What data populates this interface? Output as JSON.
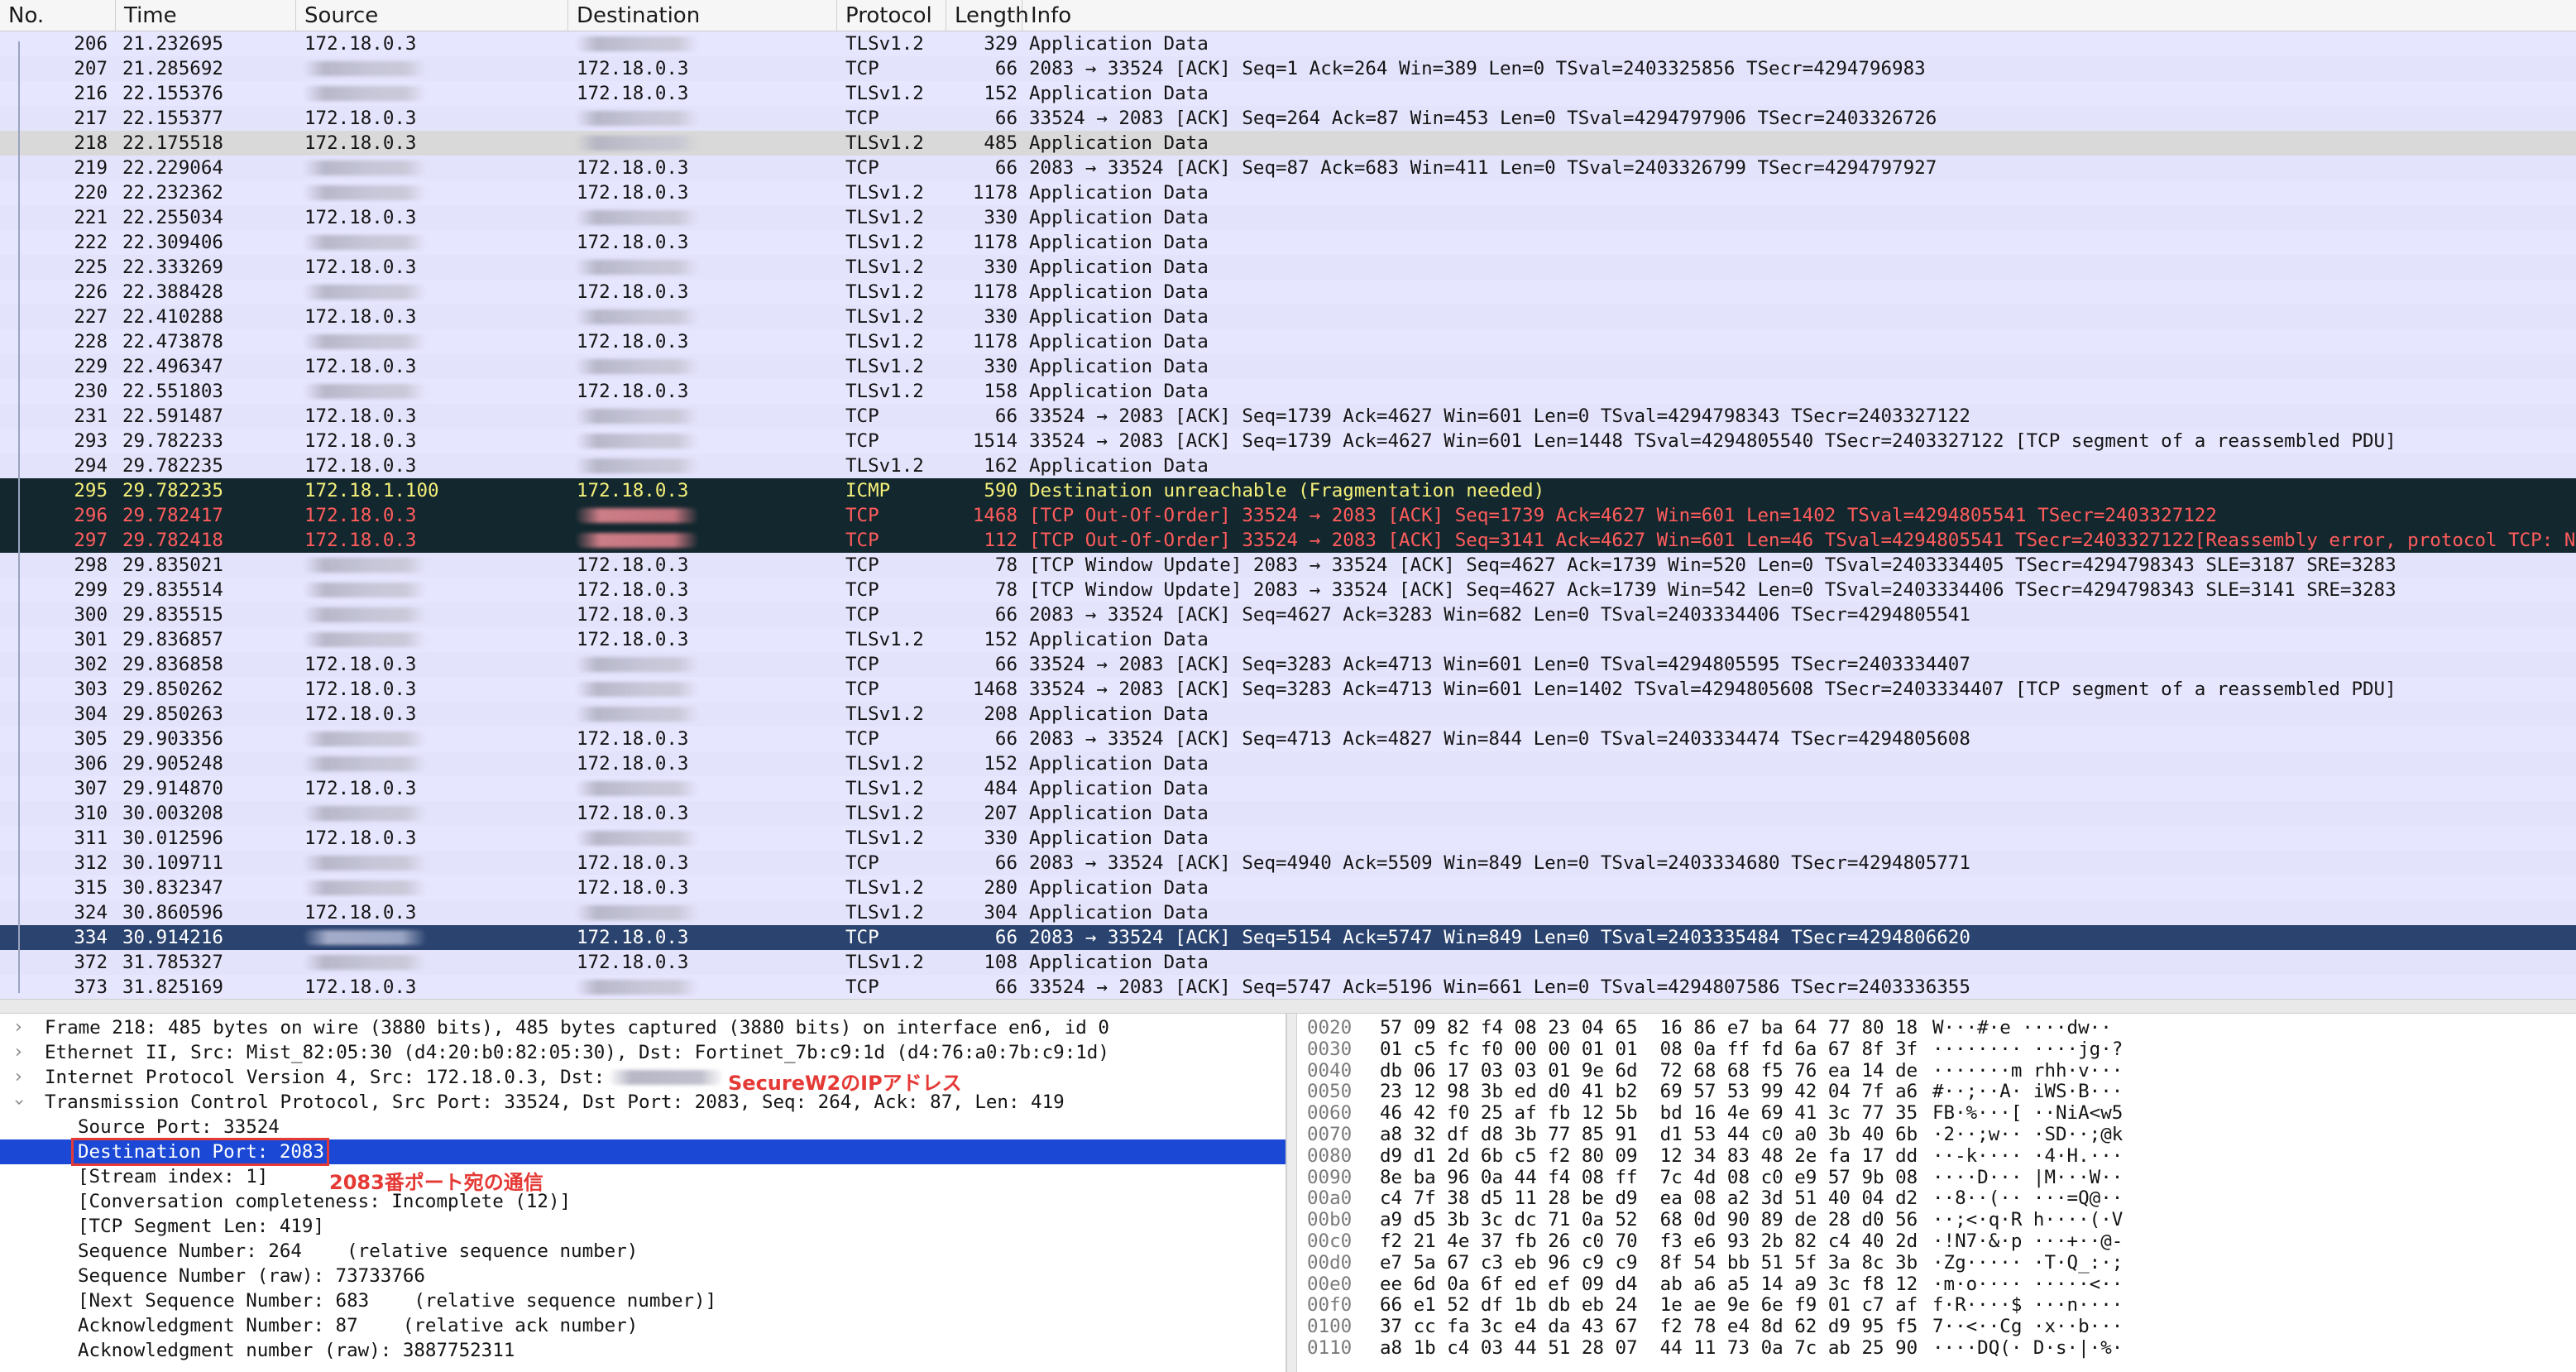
{
  "columns": [
    "No.",
    "Time",
    "Source",
    "Destination",
    "Protocol",
    "Length",
    "Info"
  ],
  "colors": {
    "normal_row_bg": "#e7e6ff",
    "selected_gray_bg": "#d9d9d9",
    "dark_row_bg": "#12272e",
    "icmp_text": "#f5f07a",
    "error_text": "#ff5c5c",
    "current_row_bg": "#2b436f",
    "details_selected_bg": "#1b49d6",
    "annotation_red": "#e53935"
  },
  "packets": [
    {
      "no": "206",
      "time": "21.232695",
      "src": "172.18.0.3",
      "dst": "",
      "proto": "TLSv1.2",
      "len": "329",
      "info": "Application Data",
      "style": "normal"
    },
    {
      "no": "207",
      "time": "21.285692",
      "src": "",
      "dst": "172.18.0.3",
      "proto": "TCP",
      "len": "66",
      "info": "2083 → 33524 [ACK] Seq=1 Ack=264 Win=389 Len=0 TSval=2403325856 TSecr=4294796983",
      "style": "normal"
    },
    {
      "no": "216",
      "time": "22.155376",
      "src": "",
      "dst": "172.18.0.3",
      "proto": "TLSv1.2",
      "len": "152",
      "info": "Application Data",
      "style": "normal"
    },
    {
      "no": "217",
      "time": "22.155377",
      "src": "172.18.0.3",
      "dst": "",
      "proto": "TCP",
      "len": "66",
      "info": "33524 → 2083 [ACK] Seq=264 Ack=87 Win=453 Len=0 TSval=4294797906 TSecr=2403326726",
      "style": "normal"
    },
    {
      "no": "218",
      "time": "22.175518",
      "src": "172.18.0.3",
      "dst": "",
      "proto": "TLSv1.2",
      "len": "485",
      "info": "Application Data",
      "style": "gray"
    },
    {
      "no": "219",
      "time": "22.229064",
      "src": "",
      "dst": "172.18.0.3",
      "proto": "TCP",
      "len": "66",
      "info": "2083 → 33524 [ACK] Seq=87 Ack=683 Win=411 Len=0 TSval=2403326799 TSecr=4294797927",
      "style": "normal"
    },
    {
      "no": "220",
      "time": "22.232362",
      "src": "",
      "dst": "172.18.0.3",
      "proto": "TLSv1.2",
      "len": "1178",
      "info": "Application Data",
      "style": "normal"
    },
    {
      "no": "221",
      "time": "22.255034",
      "src": "172.18.0.3",
      "dst": "",
      "proto": "TLSv1.2",
      "len": "330",
      "info": "Application Data",
      "style": "normal"
    },
    {
      "no": "222",
      "time": "22.309406",
      "src": "",
      "dst": "172.18.0.3",
      "proto": "TLSv1.2",
      "len": "1178",
      "info": "Application Data",
      "style": "normal"
    },
    {
      "no": "225",
      "time": "22.333269",
      "src": "172.18.0.3",
      "dst": "",
      "proto": "TLSv1.2",
      "len": "330",
      "info": "Application Data",
      "style": "normal"
    },
    {
      "no": "226",
      "time": "22.388428",
      "src": "",
      "dst": "172.18.0.3",
      "proto": "TLSv1.2",
      "len": "1178",
      "info": "Application Data",
      "style": "normal"
    },
    {
      "no": "227",
      "time": "22.410288",
      "src": "172.18.0.3",
      "dst": "",
      "proto": "TLSv1.2",
      "len": "330",
      "info": "Application Data",
      "style": "normal"
    },
    {
      "no": "228",
      "time": "22.473878",
      "src": "",
      "dst": "172.18.0.3",
      "proto": "TLSv1.2",
      "len": "1178",
      "info": "Application Data",
      "style": "normal"
    },
    {
      "no": "229",
      "time": "22.496347",
      "src": "172.18.0.3",
      "dst": "",
      "proto": "TLSv1.2",
      "len": "330",
      "info": "Application Data",
      "style": "normal"
    },
    {
      "no": "230",
      "time": "22.551803",
      "src": "",
      "dst": "172.18.0.3",
      "proto": "TLSv1.2",
      "len": "158",
      "info": "Application Data",
      "style": "normal"
    },
    {
      "no": "231",
      "time": "22.591487",
      "src": "172.18.0.3",
      "dst": "",
      "proto": "TCP",
      "len": "66",
      "info": "33524 → 2083 [ACK] Seq=1739 Ack=4627 Win=601 Len=0 TSval=4294798343 TSecr=2403327122",
      "style": "normal"
    },
    {
      "no": "293",
      "time": "29.782233",
      "src": "172.18.0.3",
      "dst": "",
      "proto": "TCP",
      "len": "1514",
      "info": "33524 → 2083 [ACK] Seq=1739 Ack=4627 Win=601 Len=1448 TSval=4294805540 TSecr=2403327122 [TCP segment of a reassembled PDU]",
      "style": "normal"
    },
    {
      "no": "294",
      "time": "29.782235",
      "src": "172.18.0.3",
      "dst": "",
      "proto": "TLSv1.2",
      "len": "162",
      "info": "Application Data",
      "style": "normal"
    },
    {
      "no": "295",
      "time": "29.782235",
      "src": "172.18.1.100",
      "dst": "172.18.0.3",
      "proto": "ICMP",
      "len": "590",
      "info": "Destination unreachable (Fragmentation needed)",
      "style": "icmp"
    },
    {
      "no": "296",
      "time": "29.782417",
      "src": "172.18.0.3",
      "dst": "",
      "proto": "TCP",
      "len": "1468",
      "info": "[TCP Out-Of-Order] 33524 → 2083 [ACK] Seq=1739 Ack=4627 Win=601 Len=1402 TSval=4294805541 TSecr=2403327122",
      "style": "error"
    },
    {
      "no": "297",
      "time": "29.782418",
      "src": "172.18.0.3",
      "dst": "",
      "proto": "TCP",
      "len": "112",
      "info": "[TCP Out-Of-Order] 33524 → 2083 [ACK] Seq=3141 Ack=4627 Win=601 Len=46 TSval=4294805541 TSecr=2403327122[Reassembly error, protocol TCP: New …",
      "style": "error"
    },
    {
      "no": "298",
      "time": "29.835021",
      "src": "",
      "dst": "172.18.0.3",
      "proto": "TCP",
      "len": "78",
      "info": "[TCP Window Update] 2083 → 33524 [ACK] Seq=4627 Ack=1739 Win=520 Len=0 TSval=2403334405 TSecr=4294798343 SLE=3187 SRE=3283",
      "style": "normal"
    },
    {
      "no": "299",
      "time": "29.835514",
      "src": "",
      "dst": "172.18.0.3",
      "proto": "TCP",
      "len": "78",
      "info": "[TCP Window Update] 2083 → 33524 [ACK] Seq=4627 Ack=1739 Win=542 Len=0 TSval=2403334406 TSecr=4294798343 SLE=3141 SRE=3283",
      "style": "normal"
    },
    {
      "no": "300",
      "time": "29.835515",
      "src": "",
      "dst": "172.18.0.3",
      "proto": "TCP",
      "len": "66",
      "info": "2083 → 33524 [ACK] Seq=4627 Ack=3283 Win=682 Len=0 TSval=2403334406 TSecr=4294805541",
      "style": "normal"
    },
    {
      "no": "301",
      "time": "29.836857",
      "src": "",
      "dst": "172.18.0.3",
      "proto": "TLSv1.2",
      "len": "152",
      "info": "Application Data",
      "style": "normal"
    },
    {
      "no": "302",
      "time": "29.836858",
      "src": "172.18.0.3",
      "dst": "",
      "proto": "TCP",
      "len": "66",
      "info": "33524 → 2083 [ACK] Seq=3283 Ack=4713 Win=601 Len=0 TSval=4294805595 TSecr=2403334407",
      "style": "normal"
    },
    {
      "no": "303",
      "time": "29.850262",
      "src": "172.18.0.3",
      "dst": "",
      "proto": "TCP",
      "len": "1468",
      "info": "33524 → 2083 [ACK] Seq=3283 Ack=4713 Win=601 Len=1402 TSval=4294805608 TSecr=2403334407 [TCP segment of a reassembled PDU]",
      "style": "normal"
    },
    {
      "no": "304",
      "time": "29.850263",
      "src": "172.18.0.3",
      "dst": "",
      "proto": "TLSv1.2",
      "len": "208",
      "info": "Application Data",
      "style": "normal"
    },
    {
      "no": "305",
      "time": "29.903356",
      "src": "",
      "dst": "172.18.0.3",
      "proto": "TCP",
      "len": "66",
      "info": "2083 → 33524 [ACK] Seq=4713 Ack=4827 Win=844 Len=0 TSval=2403334474 TSecr=4294805608",
      "style": "normal"
    },
    {
      "no": "306",
      "time": "29.905248",
      "src": "",
      "dst": "172.18.0.3",
      "proto": "TLSv1.2",
      "len": "152",
      "info": "Application Data",
      "style": "normal"
    },
    {
      "no": "307",
      "time": "29.914870",
      "src": "172.18.0.3",
      "dst": "",
      "proto": "TLSv1.2",
      "len": "484",
      "info": "Application Data",
      "style": "normal"
    },
    {
      "no": "310",
      "time": "30.003208",
      "src": "",
      "dst": "172.18.0.3",
      "proto": "TLSv1.2",
      "len": "207",
      "info": "Application Data",
      "style": "normal"
    },
    {
      "no": "311",
      "time": "30.012596",
      "src": "172.18.0.3",
      "dst": "",
      "proto": "TLSv1.2",
      "len": "330",
      "info": "Application Data",
      "style": "normal"
    },
    {
      "no": "312",
      "time": "30.109711",
      "src": "",
      "dst": "172.18.0.3",
      "proto": "TCP",
      "len": "66",
      "info": "2083 → 33524 [ACK] Seq=4940 Ack=5509 Win=849 Len=0 TSval=2403334680 TSecr=4294805771",
      "style": "normal"
    },
    {
      "no": "315",
      "time": "30.832347",
      "src": "",
      "dst": "172.18.0.3",
      "proto": "TLSv1.2",
      "len": "280",
      "info": "Application Data",
      "style": "normal"
    },
    {
      "no": "324",
      "time": "30.860596",
      "src": "172.18.0.3",
      "dst": "",
      "proto": "TLSv1.2",
      "len": "304",
      "info": "Application Data",
      "style": "normal"
    },
    {
      "no": "334",
      "time": "30.914216",
      "src": "",
      "dst": "172.18.0.3",
      "proto": "TCP",
      "len": "66",
      "info": "2083 → 33524 [ACK] Seq=5154 Ack=5747 Win=849 Len=0 TSval=2403335484 TSecr=4294806620",
      "style": "selected"
    },
    {
      "no": "372",
      "time": "31.785327",
      "src": "",
      "dst": "172.18.0.3",
      "proto": "TLSv1.2",
      "len": "108",
      "info": "Application Data",
      "style": "normal"
    },
    {
      "no": "373",
      "time": "31.825169",
      "src": "172.18.0.3",
      "dst": "",
      "proto": "TCP",
      "len": "66",
      "info": "33524 → 2083 [ACK] Seq=5747 Ack=5196 Win=661 Len=0 TSval=4294807586 TSecr=2403336355",
      "style": "normal"
    }
  ],
  "details": {
    "frame": "Frame 218: 485 bytes on wire (3880 bits), 485 bytes captured (3880 bits) on interface en6, id 0",
    "ethernet": "Ethernet II, Src: Mist_82:05:30 (d4:20:b0:82:05:30), Dst: Fortinet_7b:c9:1d (d4:76:a0:7b:c9:1d)",
    "ip": "Internet Protocol Version 4, Src: 172.18.0.3, Dst:",
    "tcp": "Transmission Control Protocol, Src Port: 33524, Dst Port: 2083, Seq: 264, Ack: 87, Len: 419",
    "src_port": "Source Port: 33524",
    "dst_port": "Destination Port: 2083",
    "stream": "[Stream index: 1]",
    "conversation": "[Conversation completeness: Incomplete (12)]",
    "seglen": "[TCP Segment Len: 419]",
    "seq": "Sequence Number: 264    (relative sequence number)",
    "seq_raw": "Sequence Number (raw): 73733766",
    "next_seq": "[Next Sequence Number: 683    (relative sequence number)]",
    "ack": "Acknowledgment Number: 87    (relative ack number)",
    "ack_raw": "Acknowledgment number (raw): 3887752311",
    "annotation_ip": "SecureW2のIPアドレス",
    "annotation_port": "2083番ポート宛の通信"
  },
  "bytes": [
    {
      "off": "0020",
      "hex": "57 09 82 f4 08 23 04 65  16 86 e7 ba 64 77 80 18",
      "ascii": "W···#·e ····dw··"
    },
    {
      "off": "0030",
      "hex": "01 c5 fc f0 00 00 01 01  08 0a ff fd 6a 67 8f 3f",
      "ascii": "········ ····jg·?"
    },
    {
      "off": "0040",
      "hex": "db 06 17 03 03 01 9e 6d  72 68 68 f5 76 ea 14 de",
      "ascii": "·······m rhh·v···"
    },
    {
      "off": "0050",
      "hex": "23 12 98 3b ed d0 41 b2  69 57 53 99 42 04 7f a6",
      "ascii": "#··;··A· iWS·B···"
    },
    {
      "off": "0060",
      "hex": "46 42 f0 25 af fb 12 5b  bd 16 4e 69 41 3c 77 35",
      "ascii": "FB·%···[ ··NiA<w5"
    },
    {
      "off": "0070",
      "hex": "a8 32 df d8 3b 77 85 91  d1 53 44 c0 a0 3b 40 6b",
      "ascii": "·2··;w·· ·SD··;@k"
    },
    {
      "off": "0080",
      "hex": "d9 d1 2d 6b c5 f2 80 09  12 34 83 48 2e fa 17 dd",
      "ascii": "··-k···· ·4·H.···"
    },
    {
      "off": "0090",
      "hex": "8e ba 96 0a 44 f4 08 ff  7c 4d 08 c0 e9 57 9b 08",
      "ascii": "····D··· |M···W··"
    },
    {
      "off": "00a0",
      "hex": "c4 7f 38 d5 11 28 be d9  ea 08 a2 3d 51 40 04 d2",
      "ascii": "··8··(·· ···=Q@··"
    },
    {
      "off": "00b0",
      "hex": "a9 d5 3b 3c dc 71 0a 52  68 0d 90 89 de 28 d0 56",
      "ascii": "··;<·q·R h····(·V"
    },
    {
      "off": "00c0",
      "hex": "f2 21 4e 37 fb 26 c0 70  f3 e6 93 2b 82 c4 40 2d",
      "ascii": "·!N7·&·p ···+··@-"
    },
    {
      "off": "00d0",
      "hex": "e7 5a 67 c3 eb 96 c9 c9  8f 54 bb 51 5f 3a 8c 3b",
      "ascii": "·Zg····· ·T·Q_:·;"
    },
    {
      "off": "00e0",
      "hex": "ee 6d 0a 6f ed ef 09 d4  ab a6 a5 14 a9 3c f8 12",
      "ascii": "·m·o···· ·····<··"
    },
    {
      "off": "00f0",
      "hex": "66 e1 52 df 1b db eb 24  1e ae 9e 6e f9 01 c7 af",
      "ascii": "f·R····$ ···n····"
    },
    {
      "off": "0100",
      "hex": "37 cc fa 3c e4 da 43 67  f2 78 e4 8d 62 d9 95 f5",
      "ascii": "7··<··Cg ·x··b···"
    },
    {
      "off": "0110",
      "hex": "a8 1b c4 03 44 51 28 07  44 11 73 0a 7c ab 25 90",
      "ascii": "····DQ(· D·s·|·%·"
    }
  ]
}
